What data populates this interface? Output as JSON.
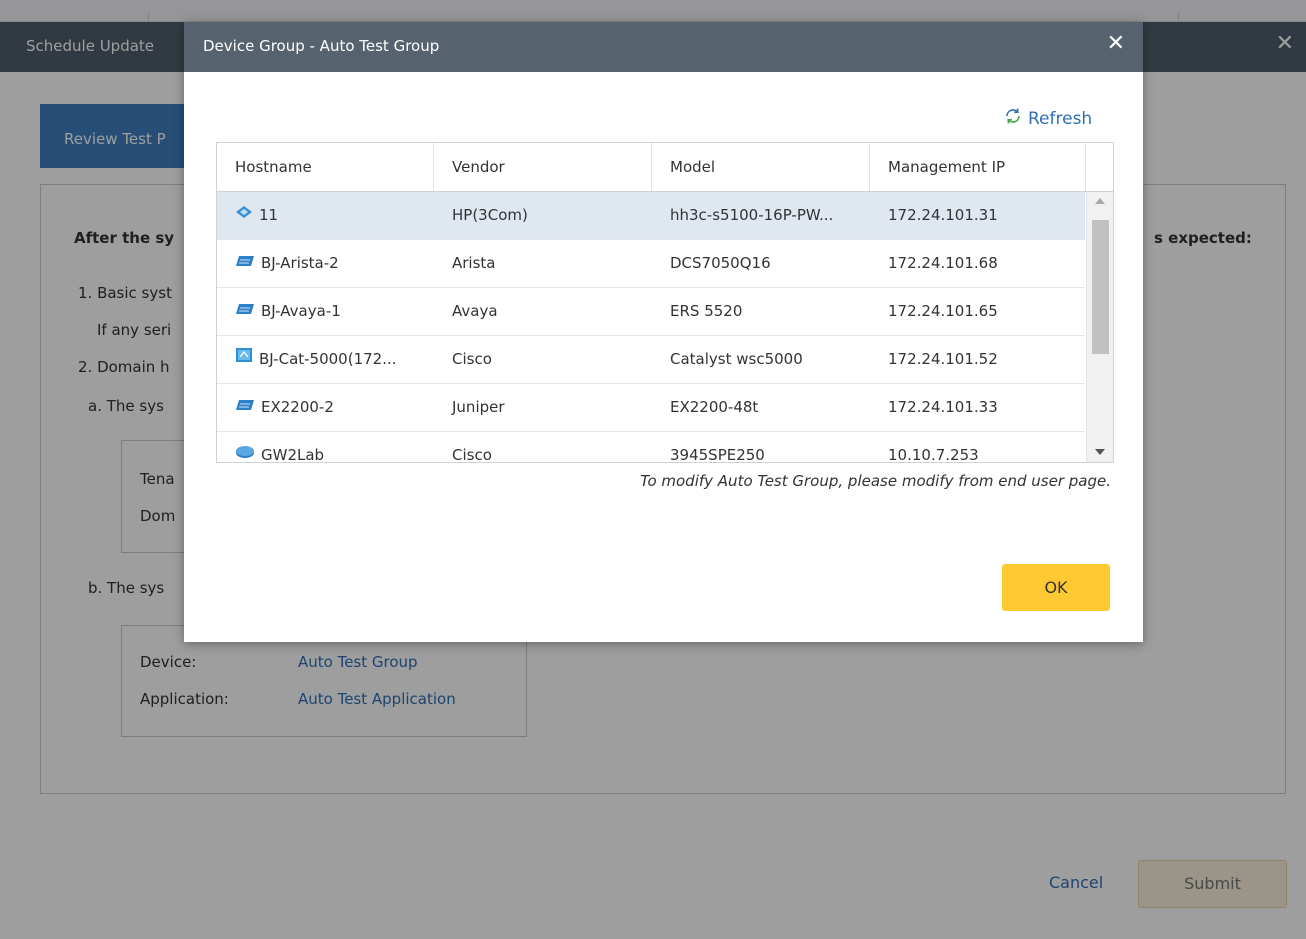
{
  "background": {
    "header_title": "Schedule Update",
    "header_close": "✕",
    "step_tab": "Review Test P",
    "after_heading": "After the sy",
    "expected_text": "s expected:",
    "items": [
      "1. Basic syst",
      "If any seri",
      "2. Domain h",
      "a. The sys"
    ],
    "box1_lines": [
      "Tena",
      "Dom"
    ],
    "item_b": "b. The sys",
    "box2": {
      "device_label": "Device:",
      "device_value": "Auto Test Group",
      "application_label": "Application:",
      "application_value": "Auto Test Application"
    },
    "cancel_label": "Cancel",
    "submit_label": "Submit"
  },
  "modal": {
    "title": "Device Group - Auto Test Group",
    "close": "✕",
    "refresh_label": "Refresh",
    "columns": [
      "Hostname",
      "Vendor",
      "Model",
      "Management IP"
    ],
    "rows": [
      {
        "icon": "hp-device-icon",
        "hostname": "11",
        "vendor": "HP(3Com)",
        "model": "hh3c-s5100-16P-PW...",
        "ip": "172.24.101.31",
        "selected": true
      },
      {
        "icon": "switch-icon",
        "hostname": "BJ-Arista-2",
        "vendor": "Arista",
        "model": "DCS7050Q16",
        "ip": "172.24.101.68",
        "selected": false
      },
      {
        "icon": "switch-icon",
        "hostname": "BJ-Avaya-1",
        "vendor": "Avaya",
        "model": "ERS 5520",
        "ip": "172.24.101.65",
        "selected": false
      },
      {
        "icon": "l3-switch-icon",
        "hostname": "BJ-Cat-5000(172...",
        "vendor": "Cisco",
        "model": "Catalyst wsc5000",
        "ip": "172.24.101.52",
        "selected": false
      },
      {
        "icon": "switch-icon",
        "hostname": "EX2200-2",
        "vendor": "Juniper",
        "model": "EX2200-48t",
        "ip": "172.24.101.33",
        "selected": false
      },
      {
        "icon": "router-icon",
        "hostname": "GW2Lab",
        "vendor": "Cisco",
        "model": "3945SPE250",
        "ip": "10.10.7.253",
        "selected": false
      }
    ],
    "note": "To modify Auto Test Group, please modify from end user page.",
    "ok_label": "OK"
  }
}
